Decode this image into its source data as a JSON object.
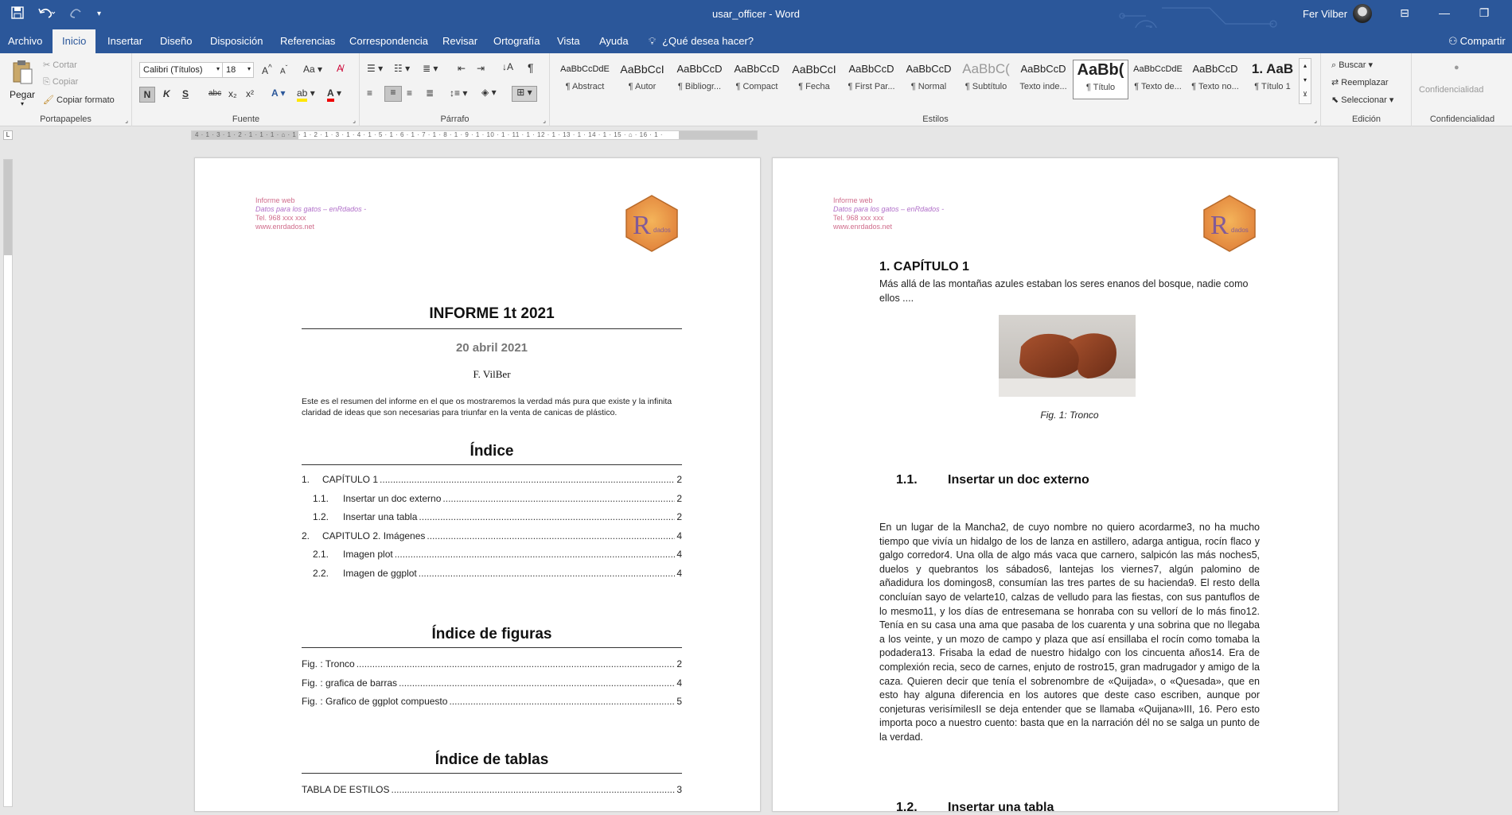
{
  "titlebar": {
    "doc_title": "usar_officer  -  Word",
    "user": "Fer Vilber",
    "qat": [
      "save-icon",
      "undo-icon",
      "redo-icon",
      "customize-icon"
    ]
  },
  "tabs": [
    {
      "label": "Archivo"
    },
    {
      "label": "Inicio"
    },
    {
      "label": "Insertar"
    },
    {
      "label": "Diseño"
    },
    {
      "label": "Disposición"
    },
    {
      "label": "Referencias"
    },
    {
      "label": "Correspondencia"
    },
    {
      "label": "Revisar"
    },
    {
      "label": "Ortografía"
    },
    {
      "label": "Vista"
    },
    {
      "label": "Ayuda"
    }
  ],
  "tell_me": "¿Qué desea hacer?",
  "share": "Compartir",
  "ribbon": {
    "clipboard": {
      "paste": "Pegar",
      "cut": "Cortar",
      "copy": "Copiar",
      "format_painter": "Copiar formato",
      "label": "Portapapeles"
    },
    "font": {
      "name": "Calibri (Títulos)",
      "size": "18",
      "change_case": "Aa",
      "bold": "N",
      "italic": "K",
      "underline": "S",
      "strike": "abc",
      "sub": "x₂",
      "sup": "x²",
      "label": "Fuente"
    },
    "paragraph": {
      "label": "Párrafo"
    },
    "styles": {
      "label": "Estilos",
      "items": [
        {
          "sample": "AaBbCcDdE",
          "name": "¶ Abstract"
        },
        {
          "sample": "AaBbCcI",
          "name": "¶ Autor"
        },
        {
          "sample": "AaBbCcD",
          "name": "¶ Bibliogr..."
        },
        {
          "sample": "AaBbCcD",
          "name": "¶ Compact"
        },
        {
          "sample": "AaBbCcI",
          "name": "¶ Fecha"
        },
        {
          "sample": "AaBbCcD",
          "name": "¶ First Par..."
        },
        {
          "sample": "AaBbCcD",
          "name": "¶ Normal"
        },
        {
          "sample": "AaBbC(",
          "name": "¶ Subtítulo"
        },
        {
          "sample": "AaBbCcD",
          "name": "Texto inde..."
        },
        {
          "sample": "AaBb(",
          "name": "¶ Título"
        },
        {
          "sample": "AaBbCcDdE",
          "name": "¶ Texto de..."
        },
        {
          "sample": "AaBbCcD",
          "name": "¶ Texto no..."
        },
        {
          "sample": "1.  AaB",
          "name": "¶ Título 1"
        }
      ]
    },
    "editing": {
      "find": "Buscar",
      "replace": "Reemplazar",
      "select": "Seleccionar",
      "label": "Edición"
    },
    "sensitivity": {
      "button": "Confidencialidad",
      "label": "Confidencialidad"
    }
  },
  "ruler": {
    "marks": "4 · 1 · 3 · 1 · 2 · 1 · 1 · 1 · ⌂ · 1 · 1 · 2 · 1 · 3 · 1 · 4 · 1 · 5 · 1 · 6 · 1 · 7 · 1 · 8 · 1 · 9 · 1 · 10 · 1 · 11 · 1 · 12 · 1 · 13 · 1 · 14 · 1 · 15 · ⌂ · 16 · 1 ·"
  },
  "page_header": {
    "line1": "Informe web",
    "line2": "Datos para los gatos – enRdados -",
    "line3": "Tel. 968 xxx xxx",
    "line4": "www.enrdados.net"
  },
  "page1": {
    "title": "INFORME 1t 2021",
    "date": "20 abril 2021",
    "author": "F. VilBer",
    "abstract": "Este es el resumen del informe en el que os mostraremos la verdad más pura que existe y la infinita claridad de ideas que son necesarias para triunfar en la venta de canicas de plástico.",
    "index_title": "Índice",
    "toc": [
      {
        "num": "1.",
        "text": "CAPÍTULO 1",
        "page": "2",
        "level": 1
      },
      {
        "num": "1.1.",
        "text": "Insertar un doc externo",
        "page": "2",
        "level": 2
      },
      {
        "num": "1.2.",
        "text": "Insertar una tabla",
        "page": "2",
        "level": 2
      },
      {
        "num": "2.",
        "text": "CAPITULO 2. Imágenes",
        "page": "4",
        "level": 1
      },
      {
        "num": "2.1.",
        "text": "Imagen plot",
        "page": "4",
        "level": 2
      },
      {
        "num": "2.2.",
        "text": "Imagen de ggplot",
        "page": "4",
        "level": 2
      }
    ],
    "figures_title": "Índice de figuras",
    "figures": [
      {
        "text": "Fig. : Tronco",
        "page": "2"
      },
      {
        "text": "Fig. : grafica de barras",
        "page": "4"
      },
      {
        "text": "Fig. : Grafico de ggplot compuesto",
        "page": "5"
      }
    ],
    "tables_title": "Índice de tablas",
    "tables": [
      {
        "text": "TABLA DE ESTILOS",
        "page": "3"
      }
    ]
  },
  "page2": {
    "chapter": "1.  CAPÍTULO 1",
    "intro": "Más allá de las montañas azules estaban los seres enanos del bosque, nadie como ellos ....",
    "figure_caption": "Fig. 1: Tronco",
    "sec1_num": "1.1.",
    "sec1_title": "Insertar un doc externo",
    "paragraph": "En un lugar de la Mancha2, de cuyo nombre no quiero acordarme3, no ha mucho tiempo que vivía un hidalgo de los de lanza en astillero, adarga antigua, rocín flaco y galgo corredor4. Una olla de algo más vaca que carnero, salpicón las más noches5, duelos y quebrantos los sábados6, lantejas los viernes7, algún palomino de añadidura los domingos8, consumían las tres partes de su hacienda9. El resto della concluían sayo de velarte10, calzas de velludo para las fiestas, con sus pantuflos de lo mesmo11, y los días de entresemana se honraba con su vellorí de lo más fino12. Tenía en su casa una ama que pasaba de los cuarenta y una sobrina que no llegaba a los veinte, y un mozo de campo y plaza que así ensillaba el rocín como tomaba la podadera13. Frisaba la edad de nuestro hidalgo con los cincuenta años14. Era de complexión recia, seco de carnes, enjuto de rostro15, gran madrugador y amigo de la caza. Quieren decir que tenía el sobrenombre de «Quijada», o «Quesada», que en esto hay alguna diferencia en los autores que deste caso escriben, aunque por conjeturas verisímilesII se deja entender que se llamaba «Quijana»III, 16. Pero esto importa poco a nuestro cuento: basta que en la narración dél no se salga un punto de la verdad.",
    "sec2_num": "1.2.",
    "sec2_title": "Insertar una tabla"
  },
  "colors": {
    "accent": "#2b579a",
    "header_pink": "#d06d8c",
    "header_purple": "#b06fc9"
  }
}
